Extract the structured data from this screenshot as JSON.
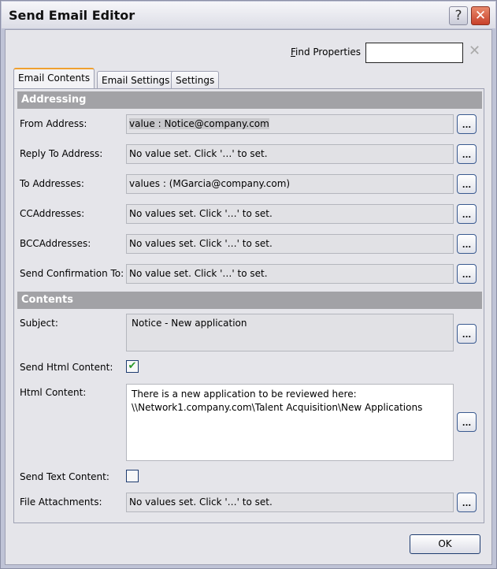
{
  "window": {
    "title": "Send Email Editor",
    "help_glyph": "?",
    "close_glyph": "✕"
  },
  "find": {
    "label_mnemonic": "F",
    "label_rest": "ind Properties",
    "value": "",
    "clear_glyph": "✕"
  },
  "tabs": [
    {
      "label": "Email Contents",
      "active": true
    },
    {
      "label": "Email Settings",
      "active": false
    },
    {
      "label": "Settings",
      "active": false
    }
  ],
  "addressing": {
    "header": "Addressing",
    "rows": [
      {
        "label": "From Address:",
        "value": "value : Notice@company.com"
      },
      {
        "label": "Reply To Address:",
        "value": "No value set. Click '…' to set."
      },
      {
        "label": "To Addresses:",
        "value": "values : (MGarcia@company.com)"
      },
      {
        "label": "CCAddresses:",
        "value": "No values set. Click '…' to set."
      },
      {
        "label": "BCCAddresses:",
        "value": "No values set. Click '…' to set."
      },
      {
        "label": "Send Confirmation To:",
        "value": "No value set. Click '…' to set."
      }
    ]
  },
  "contents": {
    "header": "Contents",
    "subject": {
      "label": "Subject:",
      "value": "Notice - New application"
    },
    "send_html": {
      "label": "Send Html Content:",
      "checked": true
    },
    "html_content": {
      "label": "Html Content:",
      "value": "There is a new application to be reviewed here:\n\\\\Network1.company.com\\Talent Acquisition\\New Applications"
    },
    "send_text": {
      "label": "Send Text Content:",
      "checked": false
    },
    "attachments": {
      "label": "File Attachments:",
      "value": "No values set. Click '…' to set."
    }
  },
  "ellipsis_label": "...",
  "ok_label": "OK",
  "check_glyph": "✔"
}
